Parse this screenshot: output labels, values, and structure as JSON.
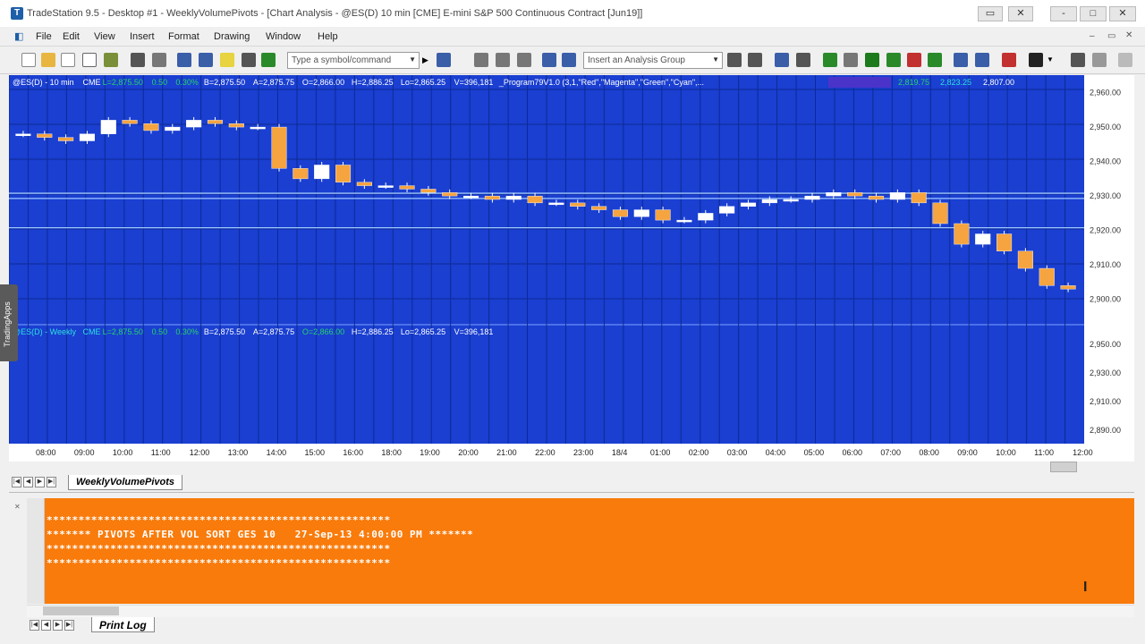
{
  "window": {
    "title": "TradeStation 9.5 - Desktop #1 - WeeklyVolumePivots - [Chart Analysis - @ES(D) 10 min [CME] E-mini S&P 500 Continuous Contract [Jun19]]",
    "controls": [
      "-",
      "□",
      "✕"
    ]
  },
  "menu": [
    "File",
    "Edit",
    "View",
    "Insert",
    "Format",
    "Drawing",
    "Window",
    "Help"
  ],
  "toolbar": {
    "symbol_placeholder": "Type a symbol/command",
    "analysis_group": "Insert an Analysis Group"
  },
  "chart": {
    "header1": {
      "symbol": "@ES(D) - 10 min",
      "exchange": "CME",
      "last": "L=2,875.50",
      "change": "0.50",
      "pct": "0.30%",
      "bid": "B=2,875.50",
      "ask": "A=2,875.75",
      "open": "O=2,866.00",
      "high": "H=2,886.25",
      "low": "Lo=2,865.25",
      "volume": "V=396,181",
      "study": "_Program79V1.0 (3,1,\"Red\",\"Magenta\",\"Green\",\"Cyan\",..."
    },
    "header1_values": [
      "2,819.75",
      "2,823.25",
      "2,807.00"
    ],
    "header2": {
      "symbol": "@ES(D) - Weekly",
      "exchange": "CME",
      "last": "L=2,875.50",
      "change": "0.50",
      "pct": "0.30%",
      "bid": "B=2,875.50",
      "ask": "A=2,875.75",
      "open": "O=2,866.00",
      "high": "H=2,886.25",
      "low": "Lo=2,865.25",
      "volume": "V=396,181"
    },
    "price_axis_top": [
      "2,960.00",
      "2,950.00",
      "2,940.00",
      "2,930.00",
      "2,920.00",
      "2,910.00",
      "2,900.00"
    ],
    "price_axis_bottom": [
      "2,950.00",
      "2,930.00",
      "2,910.00",
      "2,890.00"
    ],
    "time_axis": [
      "08:00",
      "09:00",
      "10:00",
      "11:00",
      "12:00",
      "13:00",
      "14:00",
      "15:00",
      "16:00",
      "18:00",
      "19:00",
      "20:00",
      "21:00",
      "22:00",
      "23:00",
      "18/4",
      "01:00",
      "02:00",
      "03:00",
      "04:00",
      "05:00",
      "06:00",
      "07:00",
      "08:00",
      "09:00",
      "10:00",
      "11:00",
      "12:00"
    ],
    "series": [
      2948,
      2947,
      2946,
      2948,
      2952,
      2951,
      2949,
      2950,
      2952,
      2951,
      2950,
      2950,
      2938,
      2935,
      2939,
      2934,
      2933,
      2933,
      2932,
      2931,
      2930,
      2930,
      2929,
      2930,
      2928,
      2928,
      2927,
      2926,
      2924,
      2926,
      2923,
      2923,
      2925,
      2927,
      2928,
      2929,
      2929,
      2930,
      2931,
      2930,
      2929,
      2931,
      2928,
      2922,
      2916,
      2919,
      2914,
      2909,
      2904,
      2903
    ],
    "pivot_lines": [
      2930.8,
      2929.3,
      2920.8
    ]
  },
  "sheet_tab": "WeeklyVolumePivots",
  "print_log": {
    "lines": [
      "******************************************************",
      "******* PIVOTS AFTER VOL SORT GES 10   27-Sep-13 4:00:00 PM *******",
      "******************************************************",
      "******************************************************"
    ],
    "tab": "Print Log"
  },
  "colors": {
    "chart_bg": "#1a3fd1",
    "grid": "#0d2a94",
    "up_candle": "#ffffff",
    "down_candle": "#f5a440",
    "log_bg": "#f97b0b",
    "header_green": "#27d36a",
    "header_cyan": "#2ee0e0"
  }
}
